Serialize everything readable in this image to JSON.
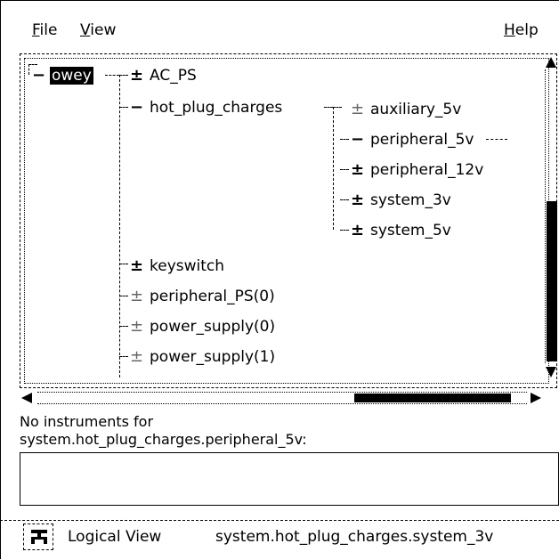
{
  "menubar": {
    "file": {
      "mnemonic": "F",
      "rest": "ile"
    },
    "view": {
      "mnemonic": "V",
      "rest": "iew"
    },
    "help": {
      "mnemonic": "H",
      "rest": "elp"
    }
  },
  "tree": {
    "root": {
      "label": "owey",
      "toggle": "−"
    },
    "nodes": [
      {
        "label": "AC_PS",
        "toggle": "±"
      },
      {
        "label": "hot_plug_charges",
        "toggle": "−"
      },
      {
        "label": "auxiliary_5v",
        "toggle": "±"
      },
      {
        "label": "peripheral_5v",
        "toggle": "−"
      },
      {
        "label": "peripheral_12v",
        "toggle": "±"
      },
      {
        "label": "system_3v",
        "toggle": "±"
      },
      {
        "label": "system_5v",
        "toggle": "±"
      },
      {
        "label": "keyswitch",
        "toggle": "±"
      },
      {
        "label": "peripheral_PS(0)",
        "toggle": "±"
      },
      {
        "label": "power_supply(0)",
        "toggle": "±"
      },
      {
        "label": "power_supply(1)",
        "toggle": "±"
      }
    ]
  },
  "status": {
    "line1": "No instruments for",
    "line2": "system.hot_plug_charges.peripheral_5v:"
  },
  "bottombar": {
    "view_label": "Logical View",
    "path": "system.hot_plug_charges.system_3v"
  }
}
